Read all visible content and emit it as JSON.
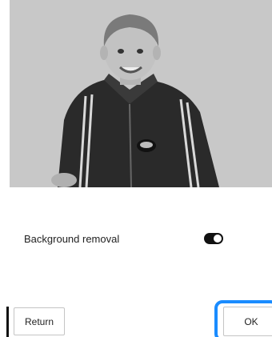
{
  "preview": {
    "photo_description_icon": "child-photo",
    "background_color": "#c8c8c8"
  },
  "settings": {
    "background_removal_label": "Background removal",
    "background_removal_enabled": true
  },
  "buttons": {
    "return_label": "Return",
    "ok_label": "OK"
  },
  "colors": {
    "focus_ring": "#1a8cff",
    "toggle_on": "#111111"
  }
}
